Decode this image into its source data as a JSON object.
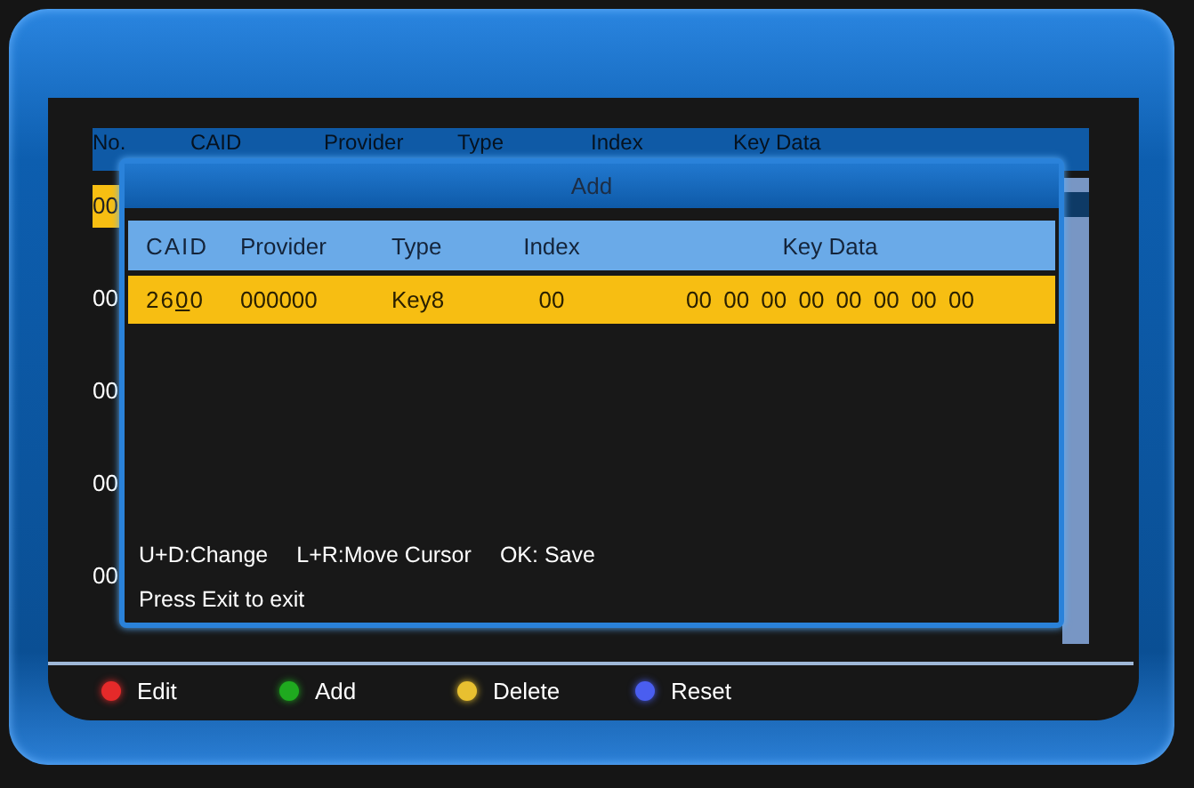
{
  "background_table": {
    "columns": [
      "No.",
      "CAID",
      "Provider",
      "Type",
      "Index",
      "Key Data"
    ],
    "rows": [
      {
        "text": "00",
        "selected": true
      },
      {
        "text": "00",
        "selected": false
      },
      {
        "text": "00",
        "selected": false
      },
      {
        "text": "00",
        "selected": false
      },
      {
        "text": "00",
        "selected": false
      }
    ]
  },
  "dialog": {
    "title": "Add",
    "columns": [
      "CAID",
      "Provider",
      "Type",
      "Index",
      "Key Data"
    ],
    "row": {
      "selected": true,
      "caid": [
        {
          "char": "2",
          "cursor": false
        },
        {
          "char": "6",
          "cursor": false
        },
        {
          "char": "0",
          "cursor": true
        },
        {
          "char": "0",
          "cursor": false
        }
      ],
      "provider": "000000",
      "type": "Key8",
      "index": "00",
      "key_data": "00 00 00 00 00 00 00 00"
    },
    "hints": [
      "U+D:Change",
      "L+R:Move Cursor",
      "OK: Save"
    ],
    "exit_hint": "Press Exit to exit"
  },
  "legend": [
    {
      "label": "Edit",
      "color": "#e52a2a"
    },
    {
      "label": "Add",
      "color": "#1faa1f"
    },
    {
      "label": "Delete",
      "color": "#e8c030"
    },
    {
      "label": "Reset",
      "color": "#4a5ef0"
    }
  ]
}
